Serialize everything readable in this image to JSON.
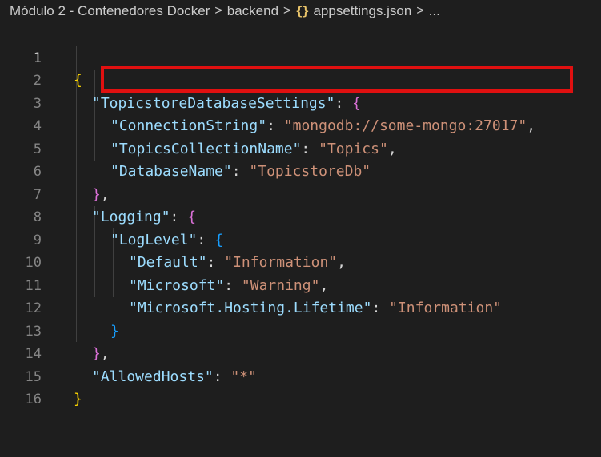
{
  "breadcrumb": {
    "items": [
      "Módulo 2 - Contenedores Docker",
      "backend",
      "appsettings.json",
      "..."
    ],
    "separator": ">",
    "json_icon": "{}"
  },
  "editor": {
    "line_numbers": [
      "1",
      "2",
      "3",
      "4",
      "5",
      "6",
      "7",
      "8",
      "9",
      "10",
      "11",
      "12",
      "13",
      "14",
      "15",
      "16"
    ],
    "active_line": 1,
    "highlighted_line": 3,
    "highlight_color": "#e01010",
    "lines": [
      {
        "tokens": [
          {
            "t": "{"
          }
        ]
      },
      {
        "tokens": [
          {
            "t": "\"TopicstoreDatabaseSettings\""
          },
          {
            "t": ": "
          },
          {
            "t": "{"
          }
        ]
      },
      {
        "tokens": [
          {
            "t": "\"ConnectionString\""
          },
          {
            "t": ": "
          },
          {
            "t": "\"mongodb://some-mongo:27017\""
          },
          {
            "t": ","
          }
        ]
      },
      {
        "tokens": [
          {
            "t": "\"TopicsCollectionName\""
          },
          {
            "t": ": "
          },
          {
            "t": "\"Topics\""
          },
          {
            "t": ","
          }
        ]
      },
      {
        "tokens": [
          {
            "t": "\"DatabaseName\""
          },
          {
            "t": ": "
          },
          {
            "t": "\"TopicstoreDb\""
          }
        ]
      },
      {
        "tokens": [
          {
            "t": "}"
          },
          {
            "t": ","
          }
        ]
      },
      {
        "tokens": [
          {
            "t": "\"Logging\""
          },
          {
            "t": ": "
          },
          {
            "t": "{"
          }
        ]
      },
      {
        "tokens": [
          {
            "t": "\"LogLevel\""
          },
          {
            "t": ": "
          },
          {
            "t": "{"
          }
        ]
      },
      {
        "tokens": [
          {
            "t": "\"Default\""
          },
          {
            "t": ": "
          },
          {
            "t": "\"Information\""
          },
          {
            "t": ","
          }
        ]
      },
      {
        "tokens": [
          {
            "t": "\"Microsoft\""
          },
          {
            "t": ": "
          },
          {
            "t": "\"Warning\""
          },
          {
            "t": ","
          }
        ]
      },
      {
        "tokens": [
          {
            "t": "\"Microsoft.Hosting.Lifetime\""
          },
          {
            "t": ": "
          },
          {
            "t": "\"Information\""
          }
        ]
      },
      {
        "tokens": [
          {
            "t": "}"
          }
        ]
      },
      {
        "tokens": [
          {
            "t": "}"
          },
          {
            "t": ","
          }
        ]
      },
      {
        "tokens": [
          {
            "t": "\"AllowedHosts\""
          },
          {
            "t": ": "
          },
          {
            "t": "\"*\""
          }
        ]
      },
      {
        "tokens": [
          {
            "t": "}"
          }
        ]
      },
      {
        "tokens": []
      }
    ]
  },
  "colors": {
    "background": "#1e1e1e",
    "key": "#9cdcfe",
    "string": "#ce9178",
    "punctuation": "#d4d4d4",
    "bracket_level1": "#ffd700",
    "bracket_level2": "#da70d6",
    "bracket_level3": "#179fff",
    "line_number": "#858585"
  }
}
